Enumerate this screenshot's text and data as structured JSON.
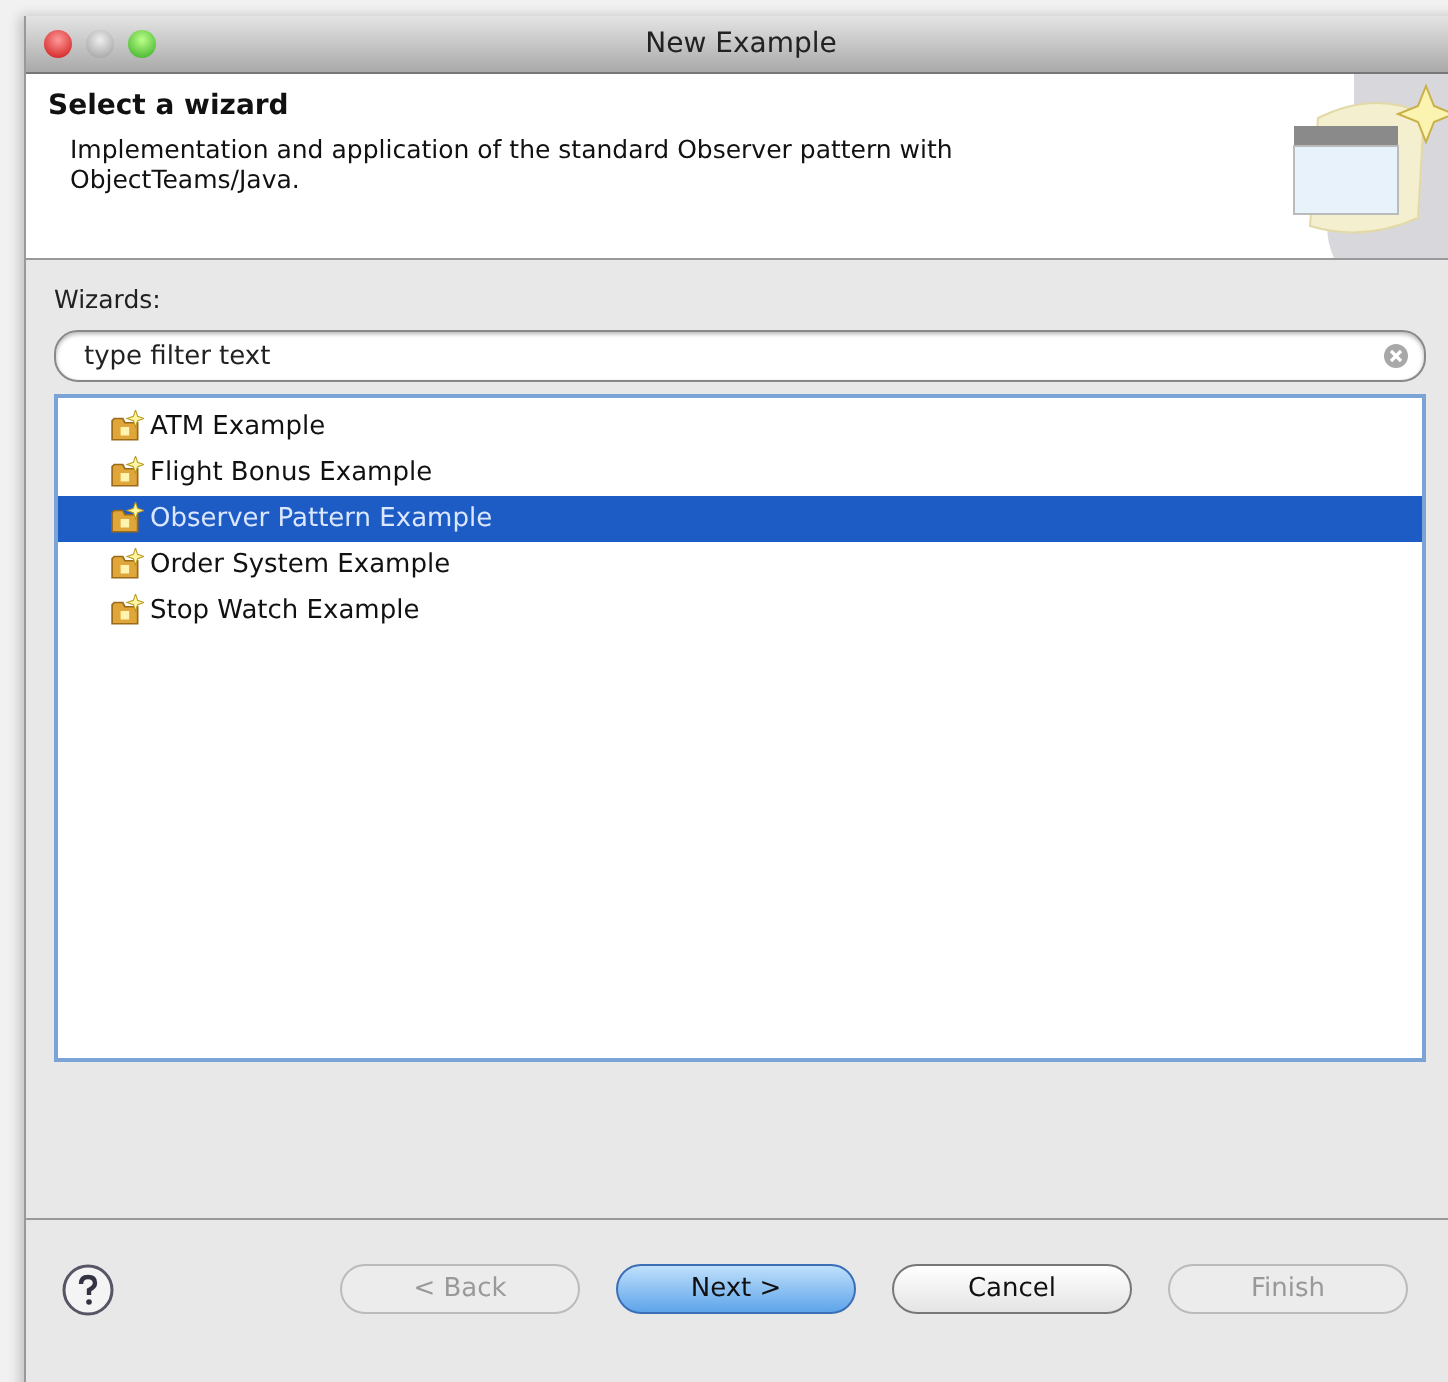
{
  "window": {
    "title": "New Example"
  },
  "header": {
    "title": "Select a wizard",
    "description": "Implementation and application of the standard Observer pattern with ObjectTeams/Java."
  },
  "wizards_label": "Wizards:",
  "filter": {
    "value": "type filter text"
  },
  "wizards": [
    {
      "label": "ATM Example",
      "selected": false
    },
    {
      "label": "Flight Bonus Example",
      "selected": false
    },
    {
      "label": "Observer Pattern Example",
      "selected": true
    },
    {
      "label": "Order System Example",
      "selected": false
    },
    {
      "label": "Stop Watch Example",
      "selected": false
    }
  ],
  "buttons": [
    {
      "label": "< Back",
      "disabled": true,
      "default": false
    },
    {
      "label": "Next >",
      "disabled": false,
      "default": true
    },
    {
      "label": "Cancel",
      "disabled": false,
      "default": false
    },
    {
      "label": "Finish",
      "disabled": true,
      "default": false
    }
  ]
}
